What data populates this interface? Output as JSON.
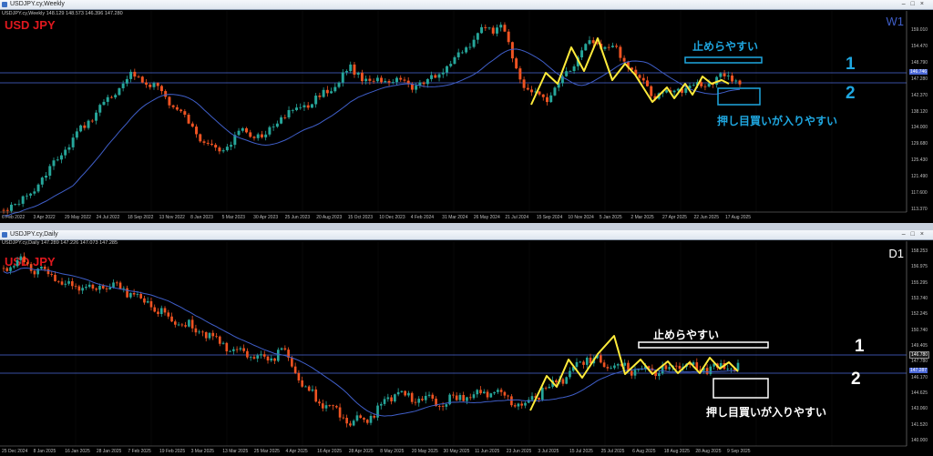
{
  "weekly": {
    "window_title": "USDJPY.cy,Weekly",
    "info": "USDJPY.cy,Weekly  148.129 148.573 146.396 147.280",
    "symbol": "USD JPY",
    "timeframe": "W1",
    "annotation_top": "止めらやすい",
    "annotation_bottom": "押し目買いが入りやすい",
    "label1": "1",
    "label2": "2",
    "dates": [
      "6 Feb 2022",
      "3 Apr 2022",
      "29 May 2022",
      "24 Jul 2022",
      "18 Sep 2022",
      "13 Nov 2022",
      "8 Jan 2023",
      "5 Mar 2023",
      "30 Apr 2023",
      "25 Jun 2023",
      "20 Aug 2023",
      "15 Oct 2023",
      "10 Dec 2023",
      "4 Feb 2024",
      "31 Mar 2024",
      "26 May 2024",
      "21 Jul 2024",
      "15 Sep 2024",
      "10 Nov 2024",
      "5 Jan 2025",
      "2 Mar 2025",
      "27 Apr 2025",
      "22 Jun 2025",
      "17 Aug 2025"
    ],
    "prices": [
      "159.010",
      "154.470",
      "148.790",
      "147.280",
      "142.370",
      "138.120",
      "134.000",
      "129.680",
      "125.430",
      "121.490",
      "117.600",
      "113.370"
    ],
    "price_highlight": "146.746",
    "colors": {
      "up": "#26a69a",
      "down": "#ef5322",
      "ma": "#3f5ec8",
      "trend": "#ffeb3b",
      "level": "#4c69d8",
      "annotation": "#1fa7e0",
      "timeframe_color": "#3f5ec8"
    }
  },
  "daily": {
    "window_title": "USDJPY.cy,Daily",
    "info": "USDJPY.cy,Daily  147.289 147.226 147.073 147.285",
    "symbol": "USD JPY",
    "timeframe": "D1",
    "annotation_top": "止めらやすい",
    "annotation_bottom": "押し目買いが入りやすい",
    "label1": "1",
    "label2": "2",
    "dates": [
      "25 Dec 2024",
      "8 Jan 2025",
      "16 Jan 2025",
      "28 Jan 2025",
      "7 Feb 2025",
      "19 Feb 2025",
      "3 Mar 2025",
      "13 Mar 2025",
      "25 Mar 2025",
      "4 Apr 2025",
      "16 Apr 2025",
      "28 Apr 2025",
      "8 May 2025",
      "20 May 2025",
      "30 May 2025",
      "11 Jun 2025",
      "23 Jun 2025",
      "3 Jul 2025",
      "15 Jul 2025",
      "25 Jul 2025",
      "6 Aug 2025",
      "18 Aug 2025",
      "28 Aug 2025",
      "9 Sep 2025"
    ],
    "prices": [
      "158.253",
      "156.975",
      "155.295",
      "153.740",
      "152.245",
      "150.740",
      "149.405",
      "147.780",
      "146.170",
      "144.625",
      "143.060",
      "141.520",
      "140.000"
    ],
    "price_highlight": "147.287",
    "price_marker": "146.780",
    "colors": {
      "up": "#26a69a",
      "down": "#ef5322",
      "ma": "#3f5ec8",
      "trend": "#ffeb3b",
      "level": "#4c69d8",
      "annotation": "#ffffff",
      "timeframe_color": "#ffffff"
    }
  }
}
